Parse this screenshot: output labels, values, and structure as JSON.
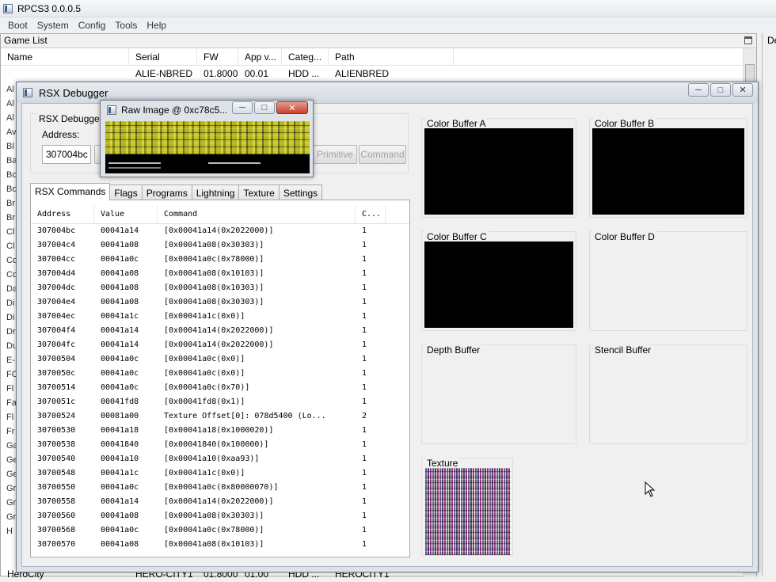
{
  "app": {
    "title": "RPCS3 0.0.0.5"
  },
  "menu": [
    "Boot",
    "System",
    "Config",
    "Tools",
    "Help"
  ],
  "game_list": {
    "title": "Game List",
    "columns": [
      "Name",
      "Serial",
      "FW",
      "App v...",
      "Categ...",
      "Path"
    ],
    "first_row": {
      "serial": "ALIE-NBRED",
      "fw": "01.8000",
      "appver": "00.01",
      "category": "HDD ...",
      "path": "ALIENBRED"
    },
    "last_row": {
      "name": "HeroCity",
      "serial": "HERO-CITY1",
      "fw": "01.8000",
      "appver": "01.00",
      "category": "HDD ...",
      "path": "HEROCITY1"
    },
    "left_letters": [
      "Al",
      "Al",
      "Al",
      "Av",
      "Bl",
      "Ba",
      "Bo",
      "Bo",
      "Br",
      "Br",
      "Cl",
      "Cl",
      "Co",
      "Co",
      "Da",
      "Di",
      "Di",
      "Dr",
      "Du",
      "E-",
      "FO",
      "Fl",
      "Fa",
      "Fl",
      "Fr",
      "Ga",
      "Ge",
      "Ge",
      "Gr",
      "Gr",
      "Gr",
      "H"
    ]
  },
  "right_dock_label": "De",
  "rsx": {
    "title": "RSX Debugger",
    "group_title": "RSX Debugger",
    "address_label": "Address:",
    "address_value": "307004bc",
    "buttons": [
      "Primitive",
      "Command"
    ],
    "tabs": [
      "RSX Commands",
      "Flags",
      "Programs",
      "Lightning",
      "Texture",
      "Settings"
    ],
    "columns": [
      "Address",
      "Value",
      "Command",
      "C..."
    ],
    "rows": [
      [
        "307004bc",
        "00041a14",
        "[0x00041a14(0x2022000)]",
        "1"
      ],
      [
        "307004c4",
        "00041a08",
        "[0x00041a08(0x30303)]",
        "1"
      ],
      [
        "307004cc",
        "00041a0c",
        "[0x00041a0c(0x78000)]",
        "1"
      ],
      [
        "307004d4",
        "00041a08",
        "[0x00041a08(0x10103)]",
        "1"
      ],
      [
        "307004dc",
        "00041a08",
        "[0x00041a08(0x10303)]",
        "1"
      ],
      [
        "307004e4",
        "00041a08",
        "[0x00041a08(0x30303)]",
        "1"
      ],
      [
        "307004ec",
        "00041a1c",
        "[0x00041a1c(0x0)]",
        "1"
      ],
      [
        "307004f4",
        "00041a14",
        "[0x00041a14(0x2022000)]",
        "1"
      ],
      [
        "307004fc",
        "00041a14",
        "[0x00041a14(0x2022000)]",
        "1"
      ],
      [
        "30700504",
        "00041a0c",
        "[0x00041a0c(0x0)]",
        "1"
      ],
      [
        "3070050c",
        "00041a0c",
        "[0x00041a0c(0x0)]",
        "1"
      ],
      [
        "30700514",
        "00041a0c",
        "[0x00041a0c(0x70)]",
        "1"
      ],
      [
        "3070051c",
        "00041fd8",
        "[0x00041fd8(0x1)]",
        "1"
      ],
      [
        "30700524",
        "00081a00",
        "Texture Offset[0]: 078d5400 (Lo...",
        "2"
      ],
      [
        "30700530",
        "00041a18",
        "[0x00041a18(0x1000020)]",
        "1"
      ],
      [
        "30700538",
        "00041840",
        "[0x00041840(0x100000)]",
        "1"
      ],
      [
        "30700540",
        "00041a10",
        "[0x00041a10(0xaa93)]",
        "1"
      ],
      [
        "30700548",
        "00041a1c",
        "[0x00041a1c(0x0)]",
        "1"
      ],
      [
        "30700550",
        "00041a0c",
        "[0x00041a0c(0x80000070)]",
        "1"
      ],
      [
        "30700558",
        "00041a14",
        "[0x00041a14(0x2022000)]",
        "1"
      ],
      [
        "30700560",
        "00041a08",
        "[0x00041a08(0x30303)]",
        "1"
      ],
      [
        "30700568",
        "00041a0c",
        "[0x00041a0c(0x78000)]",
        "1"
      ],
      [
        "30700570",
        "00041a08",
        "[0x00041a08(0x10103)]",
        "1"
      ]
    ],
    "buffers": {
      "color_a": "Color Buffer A",
      "color_b": "Color Buffer B",
      "color_c": "Color Buffer C",
      "color_d": "Color Buffer D",
      "depth": "Depth Buffer",
      "stencil": "Stencil Buffer",
      "texture": "Texture"
    }
  },
  "raw_image": {
    "title": "Raw Image @ 0xc78c5..."
  }
}
